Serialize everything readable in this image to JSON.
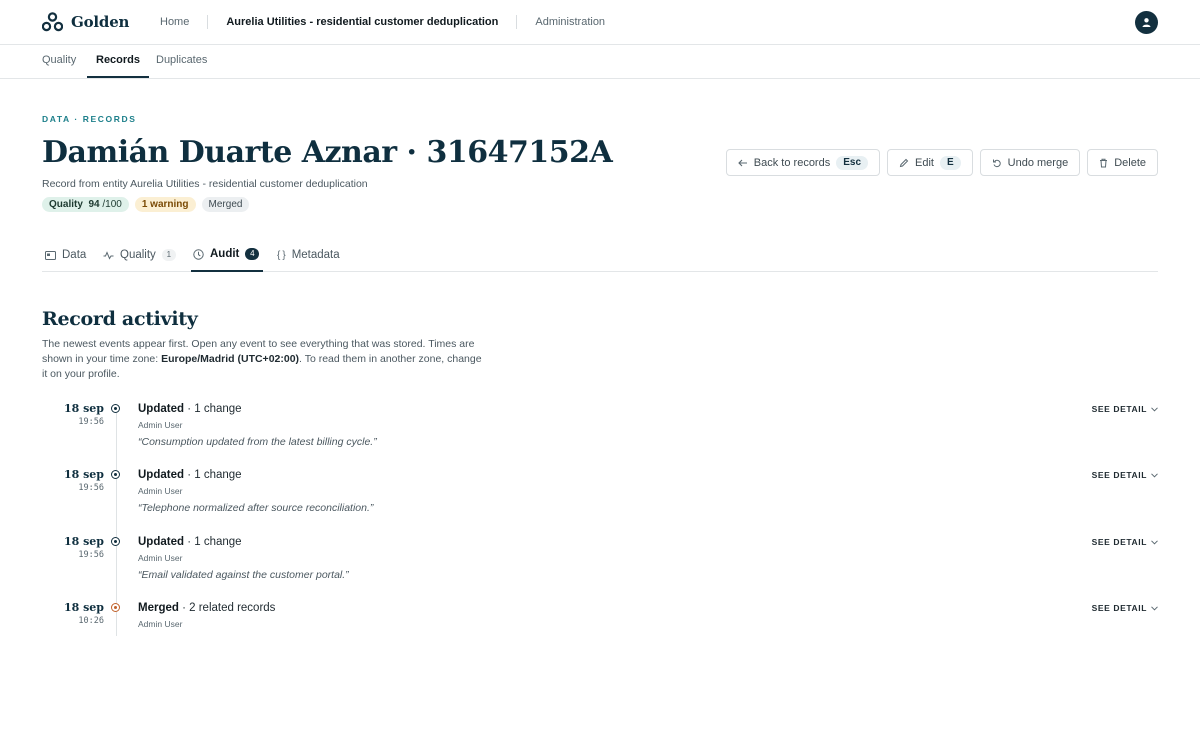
{
  "app": {
    "name": "Golden"
  },
  "topnav": {
    "home": "Home",
    "current": "Aurelia Utilities - residential customer deduplication",
    "admin": "Administration"
  },
  "subnav": [
    "Quality",
    "Records",
    "Duplicates"
  ],
  "breadcrumb": "DATA · RECORDS",
  "record": {
    "title": "Damián Duarte Aznar · 31647152A",
    "subtitle": "Record from entity Aurelia Utilities - residential customer deduplication",
    "quality_label": "Quality",
    "quality_score": "94",
    "quality_max": "/100",
    "warning": "1 warning",
    "status": "Merged"
  },
  "actions": {
    "back": "Back to records",
    "back_key": "Esc",
    "edit": "Edit",
    "edit_key": "E",
    "undo": "Undo merge",
    "delete": "Delete"
  },
  "tabs": [
    {
      "label": "Data",
      "icon": "card-icon"
    },
    {
      "label": "Quality",
      "count": "1",
      "icon": "pulse-icon"
    },
    {
      "label": "Audit",
      "count": "4",
      "icon": "clock-icon"
    },
    {
      "label": "Metadata",
      "icon": "braces-icon"
    }
  ],
  "activity": {
    "title": "Record activity",
    "desc_1": "The newest events appear first. Open any event to see everything that was stored. Times are shown in your time zone: ",
    "timezone": "Europe/Madrid (UTC+02:00)",
    "desc_2": ". To read them in another zone, change it on your profile.",
    "see_detail": "SEE DETAIL",
    "events": [
      {
        "date": "18 sep",
        "time": "19:56",
        "action": "Updated",
        "summary": "· 1 change",
        "user": "Admin User",
        "note": "“Consumption updated from the latest billing cycle.”"
      },
      {
        "date": "18 sep",
        "time": "19:56",
        "action": "Updated",
        "summary": "· 1 change",
        "user": "Admin User",
        "note": "“Telephone normalized after source reconciliation.”"
      },
      {
        "date": "18 sep",
        "time": "19:56",
        "action": "Updated",
        "summary": "· 1 change",
        "user": "Admin User",
        "note": "“Email validated against the customer portal.”"
      },
      {
        "date": "18 sep",
        "time": "10:26",
        "action": "Merged",
        "summary": "· 2 related records",
        "user": "Admin User",
        "note": ""
      }
    ]
  },
  "colors": {
    "brand": "#13303f",
    "accent": "#1c7f8a",
    "merged": "#c0612a"
  }
}
